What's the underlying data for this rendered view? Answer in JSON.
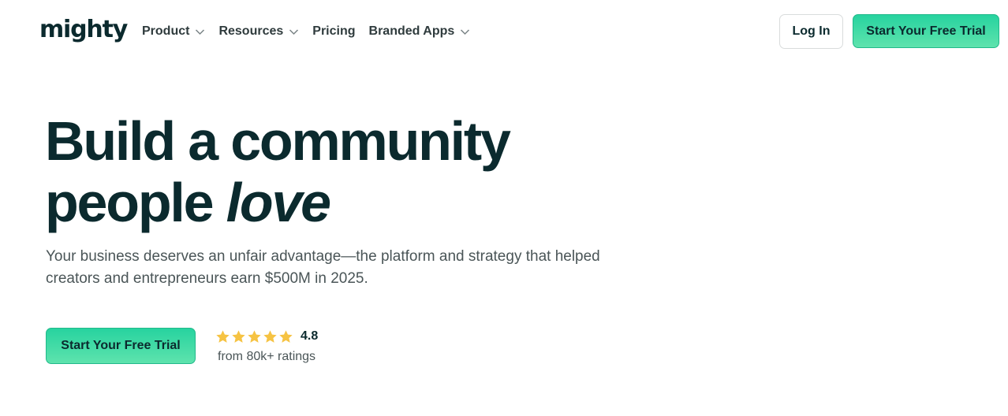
{
  "brand": {
    "logo_text": "mighty"
  },
  "nav": {
    "items": [
      {
        "label": "Product",
        "has_dropdown": true
      },
      {
        "label": "Resources",
        "has_dropdown": true
      },
      {
        "label": "Pricing",
        "has_dropdown": false
      },
      {
        "label": "Branded Apps",
        "has_dropdown": true
      }
    ],
    "login_label": "Log In",
    "trial_label": "Start Your Free Trial"
  },
  "hero": {
    "title_line1": "Build a community",
    "title_line2_plain": "people ",
    "title_line2_italic": "love",
    "subtitle": "Your business deserves an unfair advantage—the platform and strategy that helped creators and entrepreneurs earn $500M in 2025.",
    "cta_label": "Start Your Free Trial",
    "rating": {
      "stars": 5,
      "value": "4.8",
      "caption": "from 80k+ ratings"
    }
  },
  "colors": {
    "text_dark": "#0b2a2e",
    "accent_green": "#27d39f",
    "star_yellow": "#f6c343"
  },
  "icons": {
    "chevron": "chevron-down-icon",
    "star": "star-icon"
  }
}
